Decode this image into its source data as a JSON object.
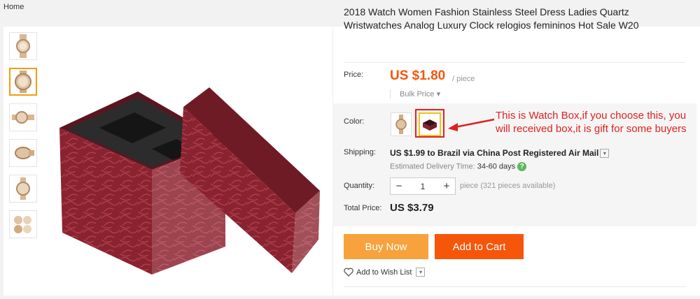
{
  "breadcrumb": {
    "home": "Home"
  },
  "product": {
    "title": "2018 Watch Women Fashion Stainless Steel Dress Ladies Quartz Wristwatches Analog Luxury Clock relogios femininos Hot Sale W20",
    "price_label": "Price:",
    "price": "US $1.80",
    "price_unit": "/ piece",
    "bulk_price": "Bulk Price ▾",
    "color_label": "Color:",
    "annotation_line1": "This is Watch Box,if you choose this, you",
    "annotation_line2": "will received box,it is gift for some buyers",
    "shipping_label": "Shipping:",
    "shipping_cost": "US $1.99",
    "shipping_to": " to Brazil via China Post Registered Air Mail",
    "delivery_label": "Estimated Delivery Time:",
    "delivery_value": "34-60 days",
    "quantity_label": "Quantity:",
    "quantity_value": "1",
    "quantity_note": "piece (321 pieces available)",
    "total_label": "Total Price:",
    "total_value": "US $3.79",
    "buy_now": "Buy Now",
    "add_to_cart": "Add to Cart",
    "wish_list": "Add to Wish List"
  },
  "colors": {
    "accent_orange": "#f5560a",
    "buy_orange": "#f7a23c",
    "annotation_red": "#e02020",
    "box_maroon": "#8a2330"
  }
}
